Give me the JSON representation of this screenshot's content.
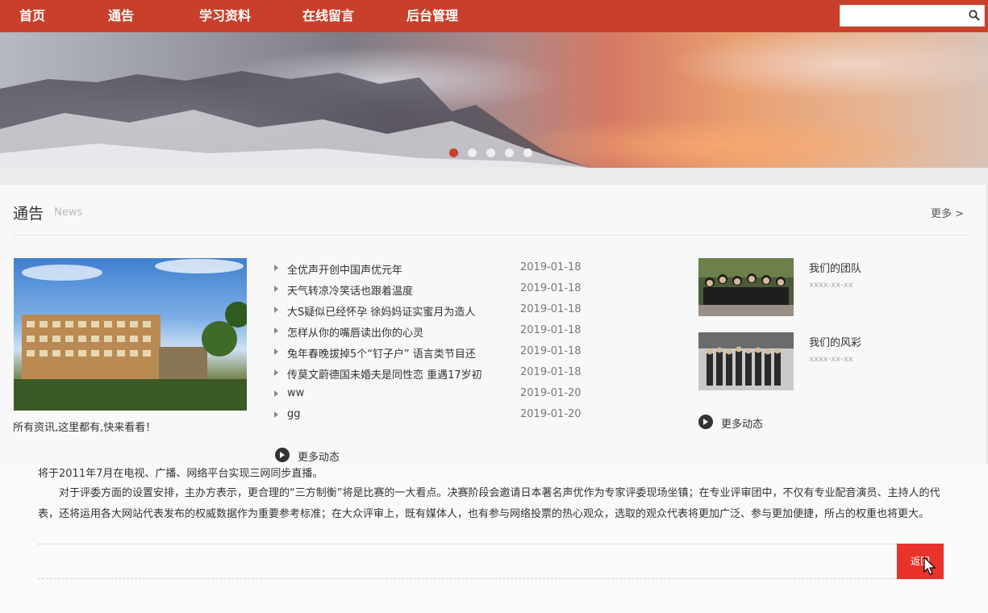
{
  "nav": {
    "items": [
      "首页",
      "通告",
      "学习资料",
      "在线留言",
      "后台管理"
    ],
    "search": {
      "value": "",
      "placeholder": ""
    }
  },
  "banner": {
    "slide_count": 5,
    "active_slide": 1
  },
  "news": {
    "title": "通告",
    "subtitle": "News",
    "more": "更多 >",
    "feature_caption": "所有资讯,这里都有,快来看看！",
    "items": [
      {
        "title": "全优声开创中国声优元年",
        "date": "2019-01-18"
      },
      {
        "title": "天气转凉冷笑话也跟着温度",
        "date": "2019-01-18"
      },
      {
        "title": "大S疑似已经怀孕 徐妈妈证实蜜月为造人",
        "date": "2019-01-18"
      },
      {
        "title": "怎样从你的嘴唇读出你的心灵",
        "date": "2019-01-18"
      },
      {
        "title": "兔年春晚拔掉5个“钉子户” 语言类节目还",
        "date": "2019-01-18"
      },
      {
        "title": "传莫文蔚德国未婚夫是同性恋 重遇17岁初",
        "date": "2019-01-18"
      },
      {
        "title": "ww",
        "date": "2019-01-20"
      },
      {
        "title": "gg",
        "date": "2019-01-20"
      }
    ],
    "more_dynamic": "更多动态",
    "teams": [
      {
        "name": "我们的团队",
        "date": "xxxx-xx-xx"
      },
      {
        "name": "我们的风彩",
        "date": "xxxx-xx-xx"
      }
    ],
    "team_more": "更多动态"
  },
  "article": {
    "line1": "将于2011年7月在电视、广播、网络平台实现三网同步直播。",
    "para2": "　　对于评委方面的设置安排，主办方表示，更合理的“三方制衡”将是比赛的一大看点。决赛阶段会邀请日本著名声优作为专家评委现场坐镇；在专业评审团中，不仅有专业配音演员、主持人的代表，还将运用各大网站代表发布的权威数据作为重要参考标准；在大众评审上，既有媒体人，也有参与网络投票的热心观众，选取的观众代表将更加广泛、参与更加便捷，所占的权重也将更大。",
    "button": "返回"
  },
  "colors": {
    "brand": "#c8402a",
    "button_red": "#e8322b"
  }
}
